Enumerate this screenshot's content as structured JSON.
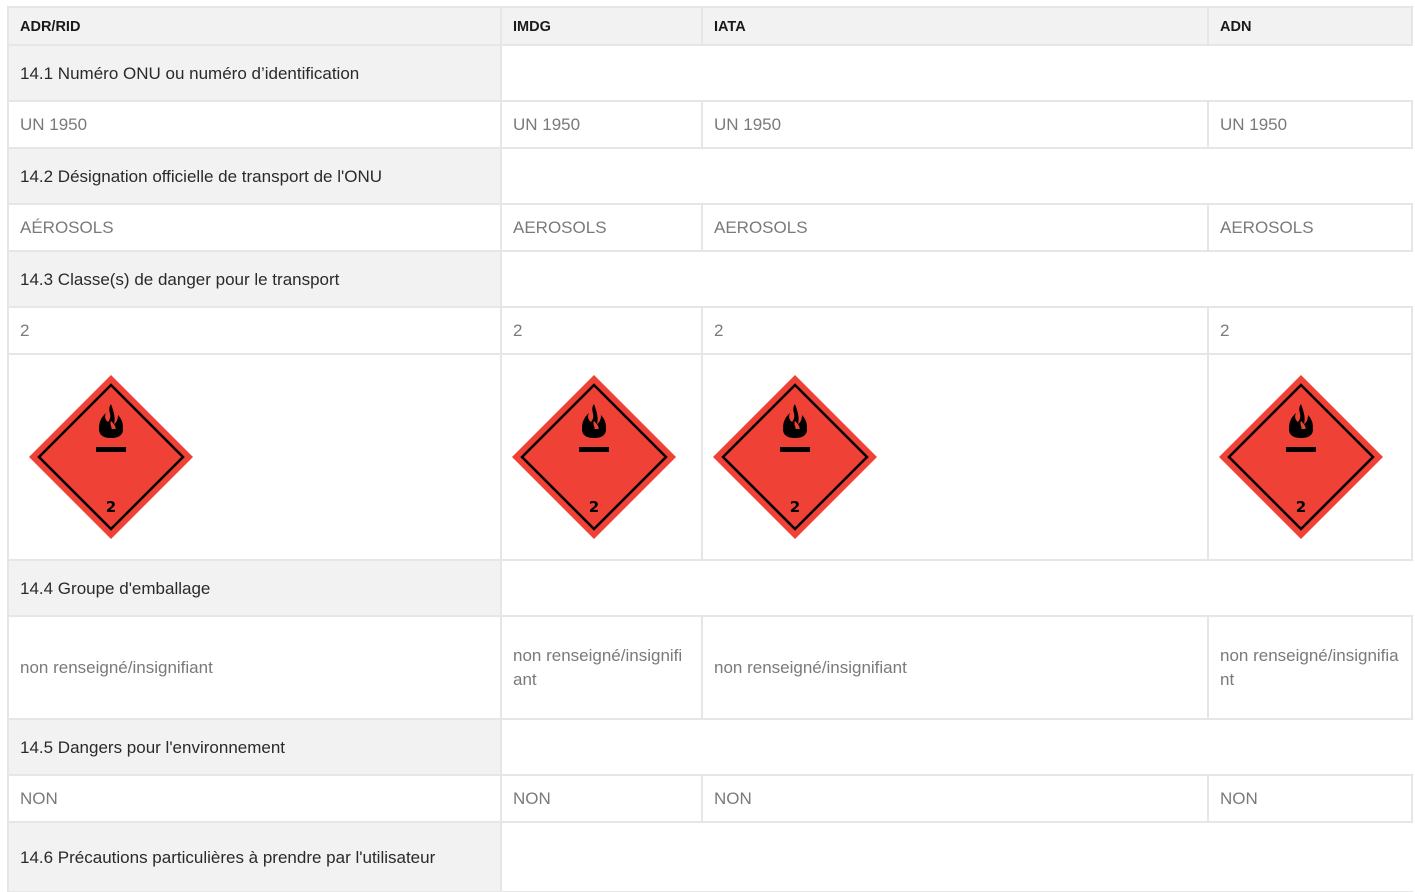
{
  "headers": [
    "ADR/RID",
    "IMDG",
    "IATA",
    "ADN"
  ],
  "sections": {
    "s1": {
      "title": "14.1 Numéro ONU ou numéro d’identification",
      "values": [
        "UN 1950",
        "UN 1950",
        "UN 1950",
        "UN 1950"
      ]
    },
    "s2": {
      "title": "14.2 Désignation officielle de transport de l'ONU",
      "values": [
        "AÉROSOLS",
        "AEROSOLS",
        "AEROSOLS",
        "AEROSOLS"
      ]
    },
    "s3": {
      "title": "14.3 Classe(s) de danger pour le transport",
      "values": [
        "2",
        "2",
        "2",
        "2"
      ],
      "pictogram": {
        "icon": "flammable-gas-class-2-icon",
        "class_number": "2",
        "fill_color": "#ef4135",
        "line_color": "#000000"
      }
    },
    "s4": {
      "title": "14.4 Groupe d'emballage",
      "values": [
        "non renseigné/insignifiant",
        "non renseigné/insignifiant",
        "non renseigné/insignifiant",
        "non renseigné/insignifiant"
      ]
    },
    "s5": {
      "title": "14.5 Dangers pour l'environnement",
      "values": [
        "NON",
        "NON",
        "NON",
        "NON"
      ]
    },
    "s6": {
      "title": "14.6 Précautions particulières à prendre par l'utilisateur"
    }
  }
}
